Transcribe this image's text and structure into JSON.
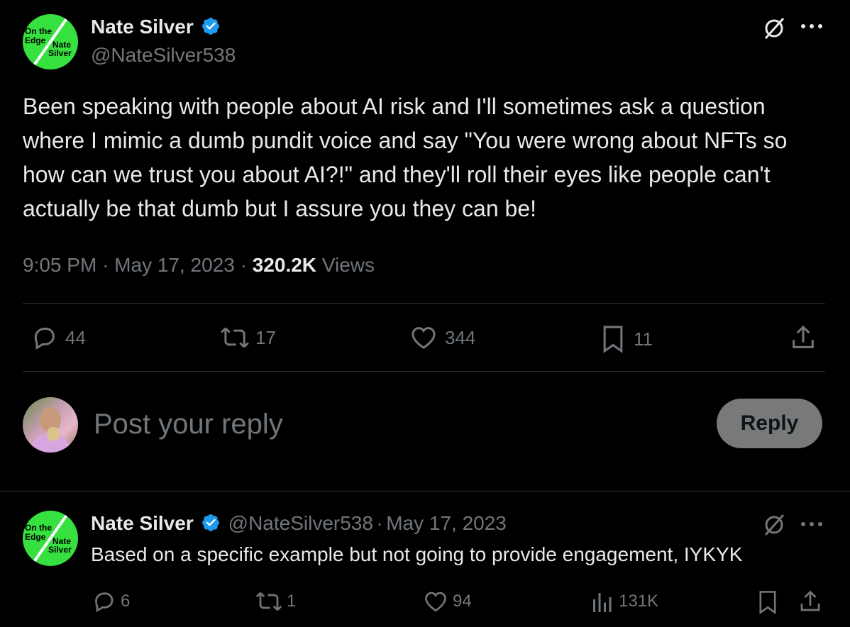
{
  "tweet": {
    "author_name": "Nate Silver",
    "handle": "@NateSilver538",
    "avatar_text": [
      "On the",
      "Edge",
      "Nate",
      "Silver"
    ],
    "body": "Been speaking with people about AI risk and I'll sometimes ask a question where I mimic a dumb pundit voice and say \"You were wrong about NFTs so how can we trust you about AI?!\" and they'll roll their eyes like people can't actually be that dumb but I assure you they can be!",
    "time": "9:05 PM",
    "date": "May 17, 2023",
    "views_count": "320.2K",
    "views_label": "Views",
    "dot": "·",
    "actions": {
      "replies": "44",
      "reposts": "17",
      "likes": "344",
      "bookmarks": "11"
    }
  },
  "reply_box": {
    "placeholder": "Post your reply",
    "button_label": "Reply"
  },
  "reply_tweet": {
    "author_name": "Nate Silver",
    "handle": "@NateSilver538",
    "dot": "·",
    "date": "May 17, 2023",
    "body": "Based on a specific example but not going to provide engagement, IYKYK",
    "actions": {
      "replies": "6",
      "reposts": "1",
      "likes": "94",
      "views": "131K"
    }
  },
  "colors": {
    "background": "#000000",
    "text": "#e7e9ea",
    "muted": "#71767b",
    "verified": "#1d9bf0",
    "brand_green": "#35e03f"
  },
  "icons": [
    "verified-badge-icon",
    "grok-icon",
    "more-icon",
    "reply-icon",
    "repost-icon",
    "like-icon",
    "bookmark-icon",
    "share-icon",
    "views-icon"
  ]
}
